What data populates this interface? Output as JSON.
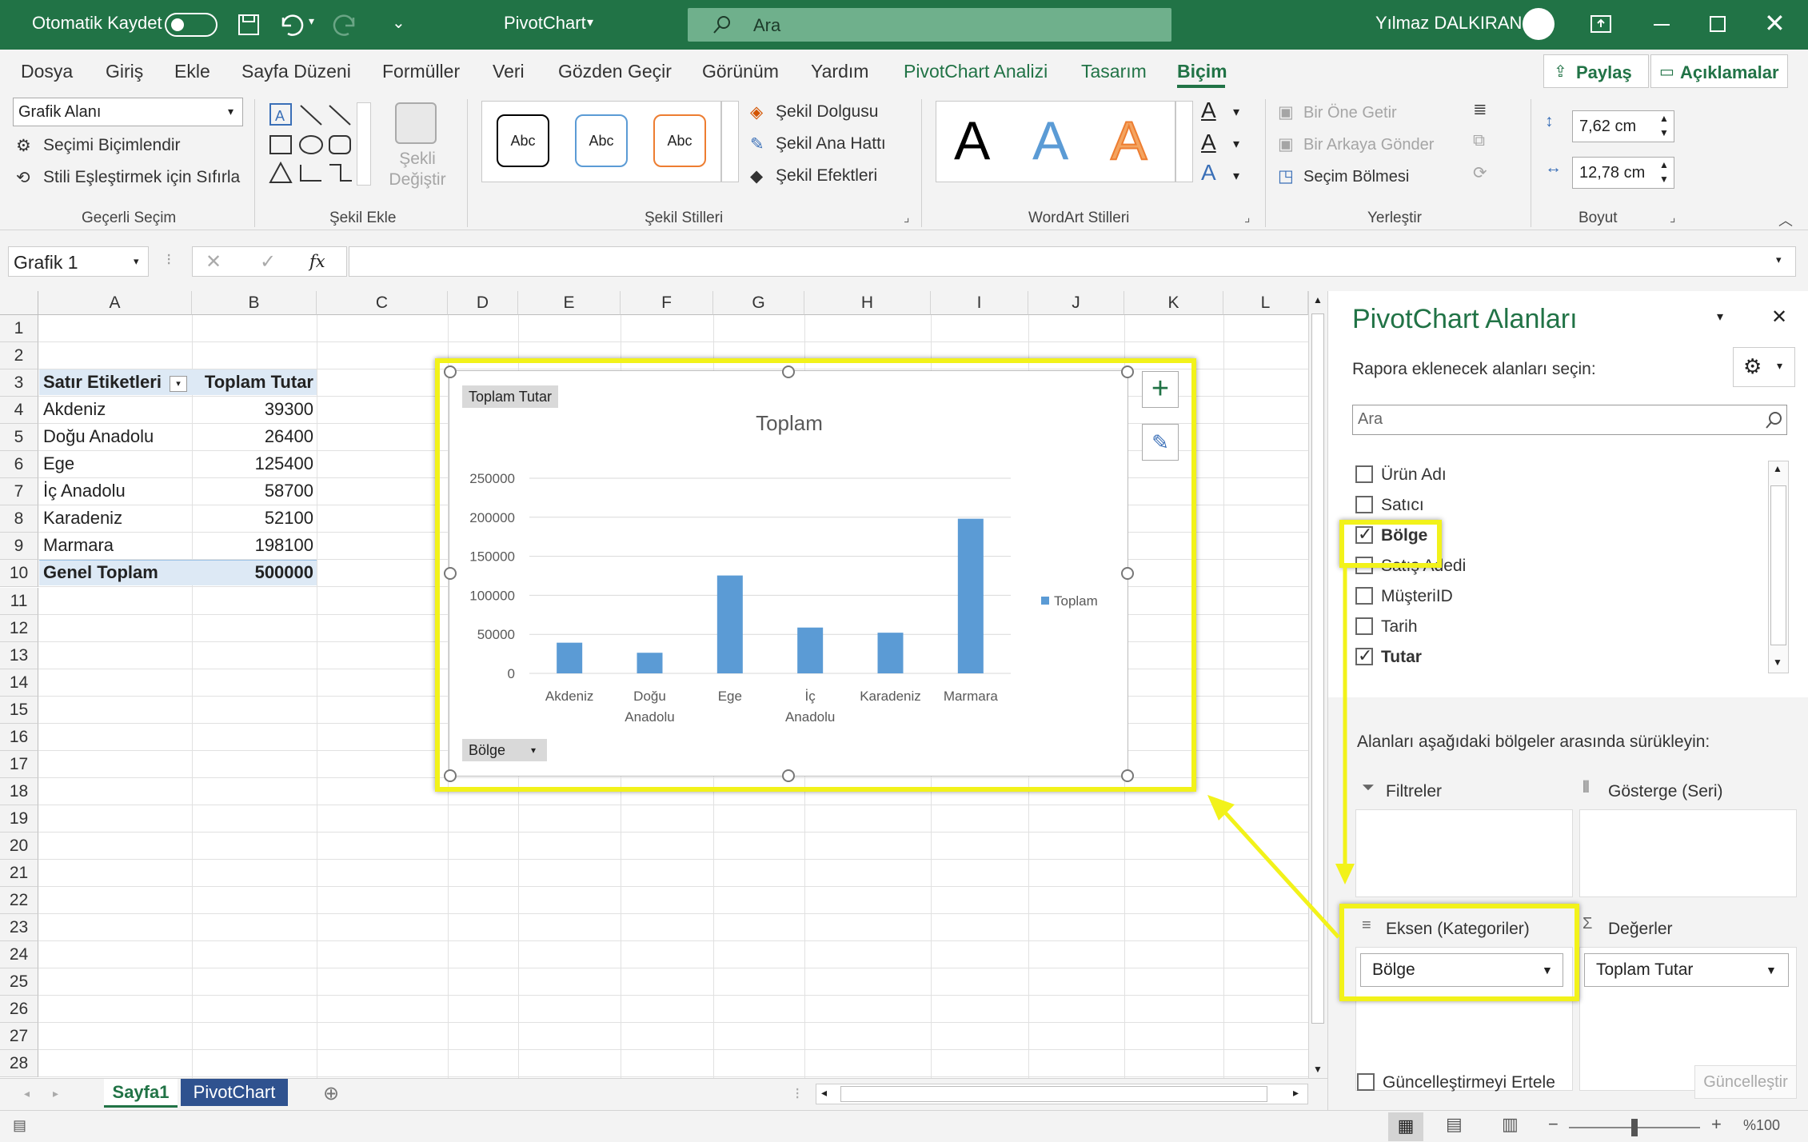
{
  "titlebar": {
    "autosave": "Otomatik Kaydet",
    "doc_title": "PivotChart",
    "search_placeholder": "Ara",
    "user": "Yılmaz DALKIRAN"
  },
  "tabs": [
    "Dosya",
    "Giriş",
    "Ekle",
    "Sayfa Düzeni",
    "Formüller",
    "Veri",
    "Gözden Geçir",
    "Görünüm",
    "Yardım",
    "PivotChart Analizi",
    "Tasarım",
    "Biçim"
  ],
  "share": {
    "share_label": "Paylaş",
    "comments_label": "Açıklamalar"
  },
  "ribbon": {
    "current_selection": {
      "dropdown": "Grafik Alanı",
      "format_sel": "Seçimi Biçimlendir",
      "reset": "Stili Eşleştirmek için Sıfırla",
      "label": "Geçerli Seçim"
    },
    "insert_shape": {
      "change_shape": "Şekli Değiştir",
      "label": "Şekil Ekle"
    },
    "shape_styles": {
      "sample": "Abc",
      "fill": "Şekil Dolgusu",
      "outline": "Şekil Ana Hattı",
      "effects": "Şekil Efektleri",
      "label": "Şekil Stilleri"
    },
    "wordart": {
      "letter": "A",
      "label": "WordArt Stilleri"
    },
    "arrange": {
      "forward": "Bir Öne Getir",
      "backward": "Bir Arkaya Gönder",
      "pane": "Seçim Bölmesi",
      "label": "Yerleştir"
    },
    "size": {
      "height": "7,62 cm",
      "width": "12,78 cm",
      "label": "Boyut"
    }
  },
  "formula": {
    "namebox": "Grafik 1",
    "fx": "fx"
  },
  "grid": {
    "columns": [
      "A",
      "B",
      "C",
      "D",
      "E",
      "F",
      "G",
      "H",
      "I",
      "J",
      "K",
      "L"
    ],
    "rows": [
      "1",
      "2",
      "3",
      "4",
      "5",
      "6",
      "7",
      "8",
      "9",
      "10",
      "11",
      "12",
      "13",
      "14",
      "15",
      "16",
      "17",
      "18",
      "19",
      "20",
      "21",
      "22",
      "23",
      "24",
      "25",
      "26",
      "27",
      "28"
    ],
    "pivot_header": [
      "Satır Etiketleri",
      "Toplam Tutar"
    ],
    "pivot_rows": [
      [
        "Akdeniz",
        "39300"
      ],
      [
        "Doğu Anadolu",
        "26400"
      ],
      [
        "Ege",
        "125400"
      ],
      [
        "İç Anadolu",
        "58700"
      ],
      [
        "Karadeniz",
        "52100"
      ],
      [
        "Marmara",
        "198100"
      ]
    ],
    "pivot_total": [
      "Genel Toplam",
      "500000"
    ]
  },
  "chart_data": {
    "type": "bar",
    "title": "Toplam",
    "field_button_value": "Toplam Tutar",
    "field_button_axis": "Bölge",
    "categories": [
      "Akdeniz",
      "Doğu Anadolu",
      "Ege",
      "İç Anadolu",
      "Karadeniz",
      "Marmara"
    ],
    "series": [
      {
        "name": "Toplam",
        "values": [
          39300,
          26400,
          125400,
          58700,
          52100,
          198100
        ]
      }
    ],
    "yticks": [
      "250000",
      "200000",
      "150000",
      "100000",
      "50000",
      "0"
    ],
    "ylim": [
      0,
      250000
    ],
    "legend": "right",
    "grid": true,
    "bar_color": "#5b9bd5"
  },
  "panel": {
    "title": "PivotChart Alanları",
    "choose": "Rapora eklenecek alanları seçin:",
    "search": "Ara",
    "fields": [
      {
        "name": "Ürün Adı",
        "checked": false
      },
      {
        "name": "Satıcı",
        "checked": false
      },
      {
        "name": "Bölge",
        "checked": true
      },
      {
        "name": "Satış Adedi",
        "checked": false
      },
      {
        "name": "MüşteriID",
        "checked": false
      },
      {
        "name": "Tarih",
        "checked": false
      },
      {
        "name": "Tutar",
        "checked": true
      }
    ],
    "drag": "Alanları aşağıdaki bölgeler arasında sürükleyin:",
    "filters": "Filtreler",
    "legend": "Gösterge (Seri)",
    "axis": "Eksen (Kategoriler)",
    "values": "Değerler",
    "axis_item": "Bölge",
    "values_item": "Toplam Tutar",
    "defer": "Güncelleştirmeyi Ertele",
    "update": "Güncelleştir"
  },
  "sheets": [
    "Sayfa1",
    "PivotChart"
  ],
  "status": {
    "zoom": "%100"
  },
  "colors": {
    "excel_green": "#217346",
    "highlight": "#f2f21a",
    "sheet_active_bg": "#2f528f"
  }
}
